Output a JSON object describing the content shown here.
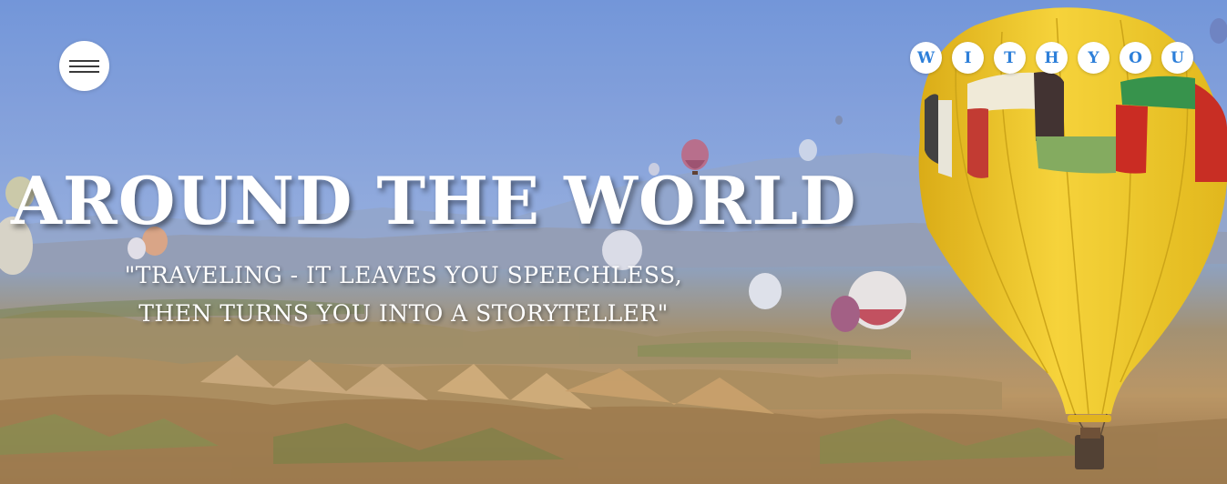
{
  "nav": {
    "menu_label": "Menu",
    "brand_letters": [
      "W",
      "I",
      "T",
      "H",
      "Y",
      "O",
      "U"
    ]
  },
  "hero": {
    "title": "AROUND THE WORLD",
    "quote_line1": "\"TRAVELING - IT LEAVES YOU SPEECHLESS,",
    "quote_line2": "THEN TURNS YOU INTO A STORYTELLER\""
  },
  "colors": {
    "sky_top": "#6f93d6",
    "brand_letter": "#2d7fd9",
    "balloon_yellow": "#f2c81f"
  },
  "icons": {
    "menu": "hamburger-icon"
  }
}
